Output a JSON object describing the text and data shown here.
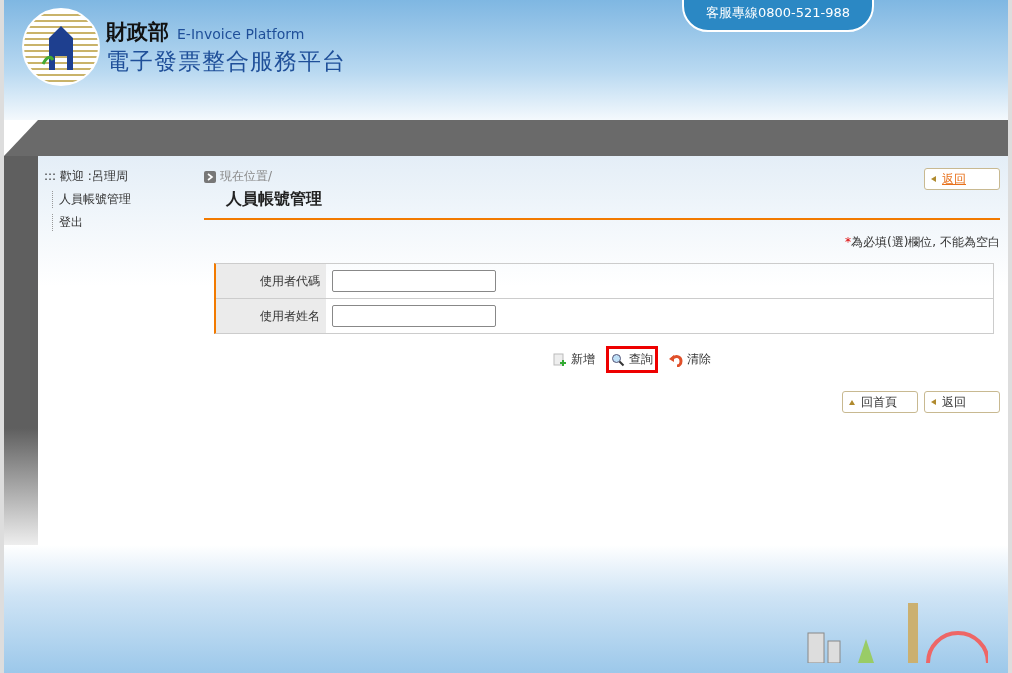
{
  "header": {
    "agency": "財政部",
    "platform_en": "E-Invoice Platform",
    "platform_zh": "電子發票整合服務平台",
    "hotline": "客服專線0800-521-988"
  },
  "sidebar": {
    "welcome": "::: 歡迎 :呂理周",
    "items": [
      {
        "label": "人員帳號管理"
      },
      {
        "label": "登出"
      }
    ]
  },
  "breadcrumb": "現在位置/",
  "page_title": "人員帳號管理",
  "top_back": "返回",
  "required_note": {
    "mark": "*",
    "text": "為必填(選)欄位, 不能為空白"
  },
  "form": [
    {
      "label": "使用者代碼"
    },
    {
      "label": "使用者姓名"
    }
  ],
  "actions": [
    {
      "kind": "add",
      "label": "新增",
      "highlighted": false
    },
    {
      "kind": "search",
      "label": "查詢",
      "highlighted": true
    },
    {
      "kind": "clear",
      "label": "清除",
      "highlighted": false
    }
  ],
  "bottom_buttons": [
    {
      "kind": "up",
      "label": "回首頁"
    },
    {
      "kind": "back",
      "label": "返回"
    }
  ]
}
